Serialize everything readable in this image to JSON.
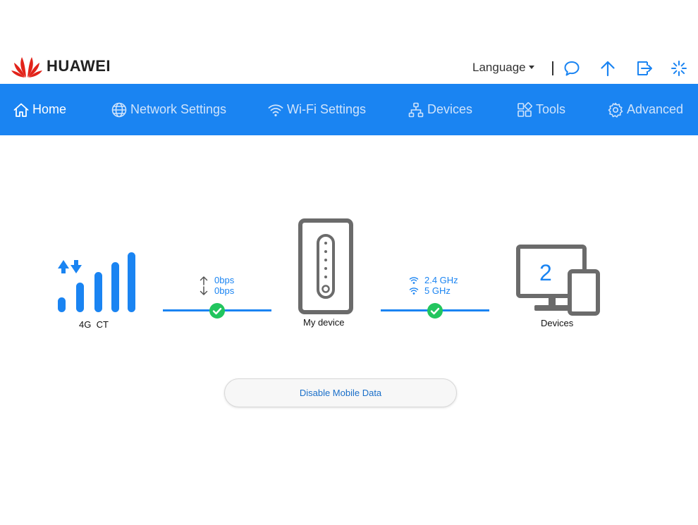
{
  "header": {
    "brand": "HUAWEI",
    "language_label": "Language",
    "icons": [
      "message-icon",
      "update-arrow-icon",
      "logout-icon",
      "loading-spinner-icon"
    ]
  },
  "nav": {
    "items": [
      {
        "label": "Home",
        "icon": "home-icon",
        "active": true
      },
      {
        "label": "Network Settings",
        "icon": "globe-icon",
        "active": false
      },
      {
        "label": "Wi-Fi Settings",
        "icon": "wifi-icon",
        "active": false
      },
      {
        "label": "Devices",
        "icon": "network-tree-icon",
        "active": false
      },
      {
        "label": "Tools",
        "icon": "tools-grid-icon",
        "active": false
      },
      {
        "label": "Advanced",
        "icon": "gear-icon",
        "active": false
      }
    ]
  },
  "status": {
    "network_type": "4G",
    "carrier": "CT",
    "upload_rate": "0bps",
    "download_rate": "0bps",
    "device_label": "My device",
    "wifi_band_1": "2.4 GHz",
    "wifi_band_2": "5 GHz",
    "devices_count": "2",
    "devices_label": "Devices"
  },
  "actions": {
    "disable_mobile_data": "Disable Mobile Data"
  },
  "colors": {
    "accent": "#1a84f2",
    "logo_red": "#e2231a",
    "success": "#22c55e",
    "device_gray": "#6b6b6b"
  }
}
